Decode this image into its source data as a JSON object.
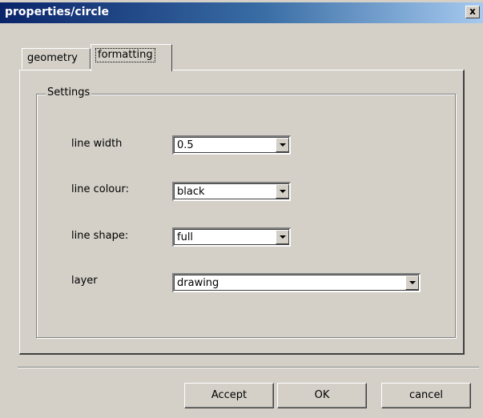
{
  "window": {
    "title": "properties/circle",
    "close_label": "x"
  },
  "tabs": [
    {
      "label": "geometry",
      "selected": false
    },
    {
      "label": "formatting",
      "selected": true
    }
  ],
  "group": {
    "title": "Settings"
  },
  "fields": {
    "line_width": {
      "label": "line width",
      "value": "0.5"
    },
    "line_colour": {
      "label": "line colour:",
      "value": "black"
    },
    "line_shape": {
      "label": "line shape:",
      "value": "full"
    },
    "layer": {
      "label": "layer",
      "value": "drawing"
    }
  },
  "buttons": {
    "accept": "Accept",
    "ok": "OK",
    "cancel": "cancel"
  },
  "colors": {
    "titlebar_start": "#0a246a",
    "titlebar_end": "#a6caf0",
    "face": "#d4d0c8"
  }
}
